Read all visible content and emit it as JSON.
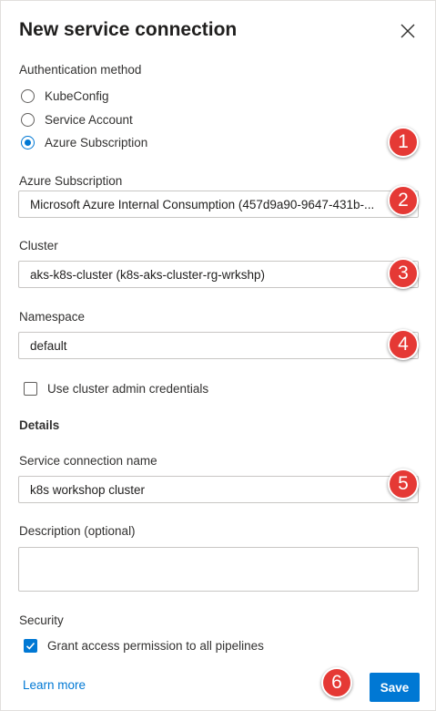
{
  "dialog": {
    "title": "New service connection"
  },
  "auth": {
    "label": "Authentication method",
    "options": [
      {
        "label": "KubeConfig",
        "selected": false
      },
      {
        "label": "Service Account",
        "selected": false
      },
      {
        "label": "Azure Subscription",
        "selected": true
      }
    ]
  },
  "subscription": {
    "label": "Azure Subscription",
    "value": "Microsoft Azure Internal Consumption (457d9a90-9647-431b-..."
  },
  "cluster": {
    "label": "Cluster",
    "value": "aks-k8s-cluster (k8s-aks-cluster-rg-wrkshp)"
  },
  "namespace": {
    "label": "Namespace",
    "value": "default"
  },
  "admin_credentials": {
    "label": "Use cluster admin credentials",
    "checked": false
  },
  "details": {
    "heading": "Details"
  },
  "connection_name": {
    "label": "Service connection name",
    "value": "k8s workshop cluster"
  },
  "description": {
    "label": "Description (optional)",
    "value": ""
  },
  "security": {
    "heading": "Security",
    "grant_label": "Grant access permission to all pipelines",
    "checked": true
  },
  "footer": {
    "learn_more": "Learn more",
    "save_label": "Save"
  },
  "annotations": [
    "1",
    "2",
    "3",
    "4",
    "5",
    "6"
  ],
  "colors": {
    "accent": "#0078d4",
    "badge": "#e53935"
  },
  "icons": {
    "close": "close-icon",
    "check": "checkmark-icon"
  }
}
